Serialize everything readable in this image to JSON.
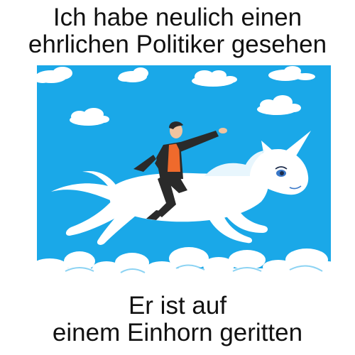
{
  "meme": {
    "top_lines": [
      "Ich habe neulich einen",
      "ehrlichen Politiker gesehen"
    ],
    "bottom_lines": [
      "Er ist auf",
      "einem Einhorn geritten"
    ]
  },
  "illustration": {
    "sky_color": "#1aa8e8",
    "cloud_color": "#ffffff",
    "unicorn_color": "#ffffff",
    "unicorn_eye_color": "#3a78c8",
    "suit_color": "#2a2a2a",
    "shirt_color": "#ef6a2c",
    "skin_color": "#f0c4a0",
    "icons": [
      "cloud-icon",
      "unicorn-icon",
      "rider-icon"
    ]
  }
}
